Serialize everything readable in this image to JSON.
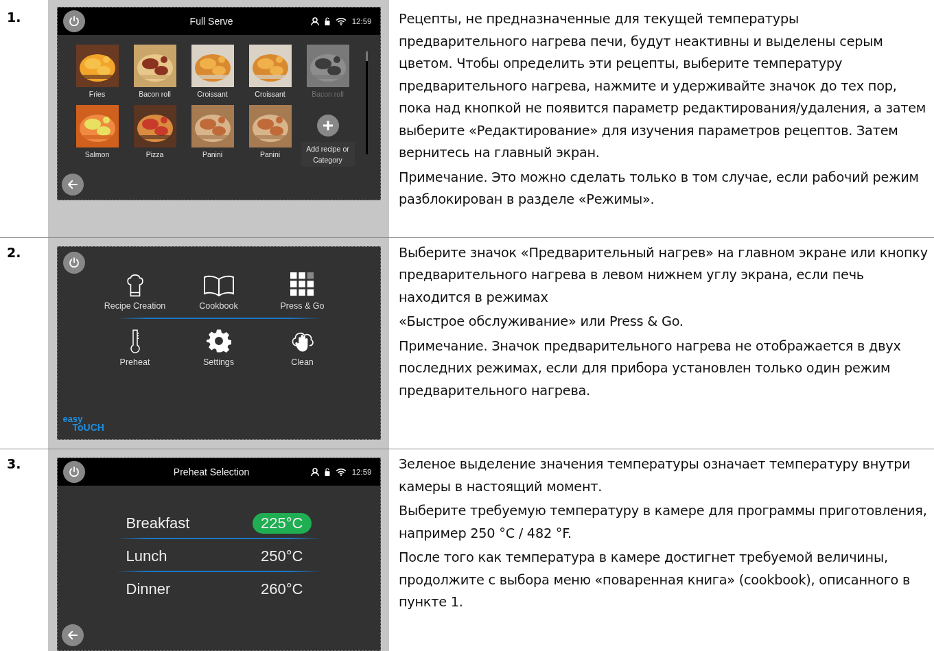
{
  "steps": [
    {
      "number": "1.",
      "screen": {
        "kind": "recipes",
        "title": "Full Serve",
        "time": "12:59",
        "items": [
          {
            "kind": "recipe",
            "name": "Fries",
            "disabled": false
          },
          {
            "kind": "recipe",
            "name": "Bacon roll",
            "disabled": false
          },
          {
            "kind": "recipe",
            "name": "Croissant",
            "disabled": false
          },
          {
            "kind": "recipe",
            "name": "Croissant",
            "disabled": false
          },
          {
            "kind": "recipe",
            "name": "Bacon roll",
            "disabled": true
          },
          {
            "kind": "recipe",
            "name": "Salmon",
            "disabled": false
          },
          {
            "kind": "recipe",
            "name": "Pizza",
            "disabled": false
          },
          {
            "kind": "recipe",
            "name": "Panini",
            "disabled": false
          },
          {
            "kind": "recipe",
            "name": "Panini",
            "disabled": false
          },
          {
            "kind": "add",
            "name": "Add recipe or Category"
          }
        ]
      },
      "paragraphs": [
        "Рецепты, не предназначенные для текущей температуры предварительного нагрева печи, будут неактивны и выделены серым цветом. Чтобы определить эти рецепты, выберите температуру предварительного нагрева, нажмите и удерживайте значок до тех пор, пока над кнопкой не появится параметр редактирования/удаления, а затем выберите «Редактирование» для изучения параметров рецептов. Затем вернитесь на главный экран.",
        "Примечание. Это можно сделать только в том случае, если рабочий режим разблокирован в разделе «Режимы»."
      ]
    },
    {
      "number": "2.",
      "screen": {
        "kind": "home",
        "items": [
          "Recipe Creation",
          "Cookbook",
          "Press & Go",
          "Preheat",
          "Settings",
          "Clean"
        ],
        "logo": [
          "easy",
          "ToUCH"
        ]
      },
      "paragraphs": [
        "Выберите значок «Предварительный нагрев» на главном экране или кнопку предварительного нагрева в левом нижнем углу экрана, если печь находится в режимах",
        "«Быстрое обслуживание» или Press & Go.",
        "Примечание. Значок предварительного нагрева не отображается в двух последних режимах, если для прибора установлен только один режим предварительного нагрева."
      ]
    },
    {
      "number": "3.",
      "screen": {
        "kind": "preheat",
        "title": "Preheat Selection",
        "time": "12:59",
        "rows": [
          {
            "label": "Breakfast",
            "temp": "225°C",
            "current": true
          },
          {
            "label": "Lunch",
            "temp": "250°C",
            "current": false
          },
          {
            "label": "Dinner",
            "temp": "260°C",
            "current": false
          }
        ]
      },
      "paragraphs": [
        "Зеленое выделение значения температуры означает температуру внутри камеры в настоящий момент.",
        "Выберите требуемую температуру в камере для программы приготовления, например 250 °C / 482 °F.",
        "После того как температура в камере достигнет требуемой величины, продолжите с выбора меню «поваренная книга» (cookbook), описанного в пункте 1."
      ]
    }
  ]
}
